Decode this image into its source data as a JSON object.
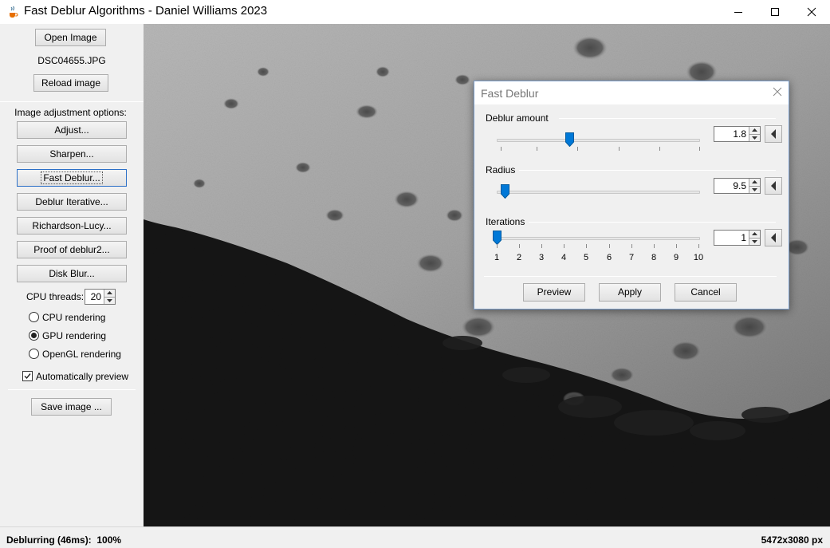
{
  "window": {
    "title": "Fast Deblur Algorithms - Daniel Williams 2023"
  },
  "left_panel": {
    "open_image_label": "Open Image",
    "filename": "DSC04655.JPG",
    "reload_label": "Reload image",
    "options_heading": "Image adjustment options:",
    "filter_buttons": [
      {
        "label": "Adjust..."
      },
      {
        "label": "Sharpen..."
      },
      {
        "label": "Fast Deblur..."
      },
      {
        "label": "Deblur Iterative..."
      },
      {
        "label": "Richardson-Lucy..."
      },
      {
        "label": "Proof of deblur2..."
      },
      {
        "label": "Disk Blur..."
      }
    ],
    "cpu_threads_label": "CPU threads:",
    "cpu_threads_value": "20",
    "render_options": [
      {
        "label": "CPU rendering",
        "selected": false
      },
      {
        "label": "GPU rendering",
        "selected": true
      },
      {
        "label": "OpenGL rendering",
        "selected": false
      }
    ],
    "auto_preview_label": "Automatically preview",
    "auto_preview_checked": true,
    "save_label": "Save image ..."
  },
  "status": {
    "left": "Deblurring (46ms):  100%",
    "right": "5472x3080 px"
  },
  "dialog": {
    "title": "Fast Deblur",
    "deblur_amount": {
      "label": "Deblur amount",
      "value": "1.8"
    },
    "radius": {
      "label": "Radius",
      "value": "9.5"
    },
    "iterations": {
      "label": "Iterations",
      "value": "1",
      "ticks": [
        "1",
        "2",
        "3",
        "4",
        "5",
        "6",
        "7",
        "8",
        "9",
        "10"
      ]
    },
    "preview_label": "Preview",
    "apply_label": "Apply",
    "cancel_label": "Cancel"
  },
  "colors": {
    "accent": "#0078d7",
    "focus_border": "#2c70c7"
  },
  "icons": {
    "app": "java-cup-icon",
    "minimize": "minimize-icon",
    "maximize": "maximize-icon",
    "close": "close-icon",
    "reset": "reset-arrow-icon"
  }
}
